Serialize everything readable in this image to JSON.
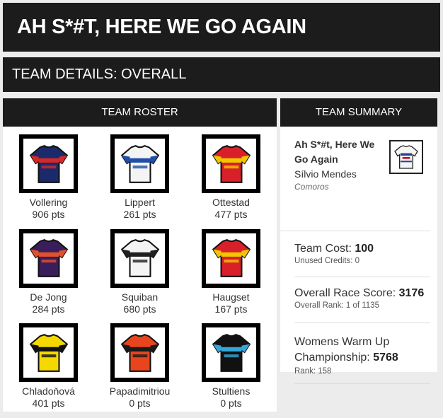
{
  "header": {
    "title": "AH S*#T, HERE WE GO AGAIN",
    "section": "TEAM DETAILS: OVERALL"
  },
  "roster": {
    "heading": "TEAM ROSTER",
    "riders": [
      {
        "name": "Vollering",
        "points": "906 pts",
        "jersey": "fdj-suez",
        "colors": [
          "#1b2a6b",
          "#d62828"
        ]
      },
      {
        "name": "Lippert",
        "points": "261 pts",
        "jersey": "movistar",
        "colors": [
          "#f4f4f4",
          "#1f4fa8"
        ]
      },
      {
        "name": "Ottestad",
        "points": "477 pts",
        "jersey": "uno-x",
        "colors": [
          "#d8202a",
          "#f2c500"
        ]
      },
      {
        "name": "De Jong",
        "points": "284 pts",
        "jersey": "human-powered-health",
        "colors": [
          "#3a1e5c",
          "#e2512a"
        ]
      },
      {
        "name": "Squiban",
        "points": "680 pts",
        "jersey": "uae-adq",
        "colors": [
          "#f4f4f4",
          "#1f1f1f"
        ]
      },
      {
        "name": "Haugset",
        "points": "167 pts",
        "jersey": "uno-x",
        "colors": [
          "#d8202a",
          "#f2c500"
        ]
      },
      {
        "name": "Chladoňová",
        "points": "401 pts",
        "jersey": "visma-lease-a-bike",
        "colors": [
          "#f5d800",
          "#111111"
        ]
      },
      {
        "name": "Papadimitriou",
        "points": "0 pts",
        "jersey": "fenix",
        "colors": [
          "#e8451e",
          "#1a1a1a"
        ]
      },
      {
        "name": "Stultiens",
        "points": "0 pts",
        "jersey": "visma",
        "colors": [
          "#111111",
          "#35a7d9"
        ]
      }
    ]
  },
  "summary": {
    "heading": "TEAM SUMMARY",
    "team_name": "Ah S*#t, Here We Go Again",
    "manager": "Sílvio Mendes",
    "country": "Comoros",
    "team_cost_label": "Team Cost:",
    "team_cost": "100",
    "unused_credits": "Unused Credits: 0",
    "race_score_label": "Overall Race Score:",
    "race_score": "3176",
    "overall_rank": "Overall Rank: 1 of 1135",
    "championship_label": "Womens Warm Up Championship:",
    "championship_score": "5768",
    "championship_rank": "Rank: 158"
  }
}
